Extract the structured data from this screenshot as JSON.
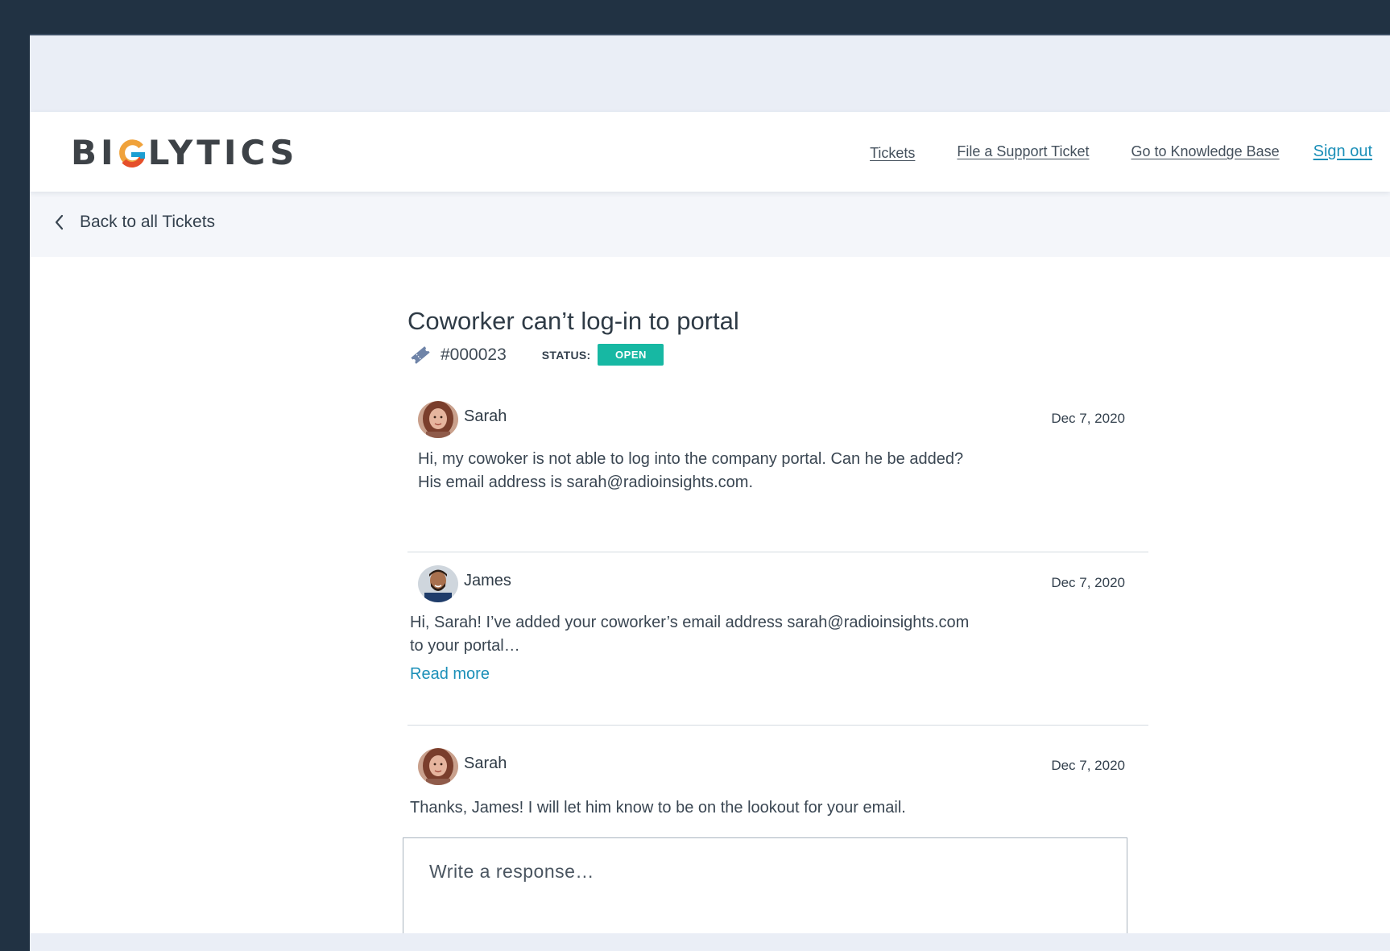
{
  "brand": {
    "logo_text_before": "BI",
    "logo_text_after": "LYTICS",
    "logo_g_colors": [
      "#f0a23a",
      "#e54f2a",
      "#1d9fd2"
    ]
  },
  "nav": {
    "tickets": "Tickets",
    "file_ticket": "File a Support Ticket",
    "knowledge_base": "Go to Knowledge Base",
    "sign_out": "Sign out"
  },
  "subbar": {
    "back_label": "Back to all Tickets"
  },
  "ticket": {
    "title": "Coworker can’t log-in to portal",
    "number": "#000023",
    "status_label": "STATUS:",
    "status_value": "OPEN",
    "status_color": "#17b8a3"
  },
  "messages": [
    {
      "author": "Sarah",
      "date": "Dec 7, 2020",
      "body_line1": "Hi,  my cowoker is not able to log into the company portal. Can he be added?",
      "body_line2": "His email address is sarah@radioinsights.com."
    },
    {
      "author": "James",
      "date": "Dec 7, 2020",
      "body_line1": "Hi, Sarah! I’ve added your coworker’s email address sarah@radioinsights.com",
      "body_line2": "to your portal…",
      "read_more": "Read more"
    },
    {
      "author": "Sarah",
      "date": "Dec 7, 2020",
      "body_line1": "Thanks, James! I will let him know to be on the lookout for your email."
    }
  ],
  "response": {
    "placeholder": "Write a response…",
    "value": ""
  },
  "colors": {
    "link_accent": "#1b8fb8",
    "frame_bg": "#213243",
    "page_bg": "#eaeef6"
  }
}
